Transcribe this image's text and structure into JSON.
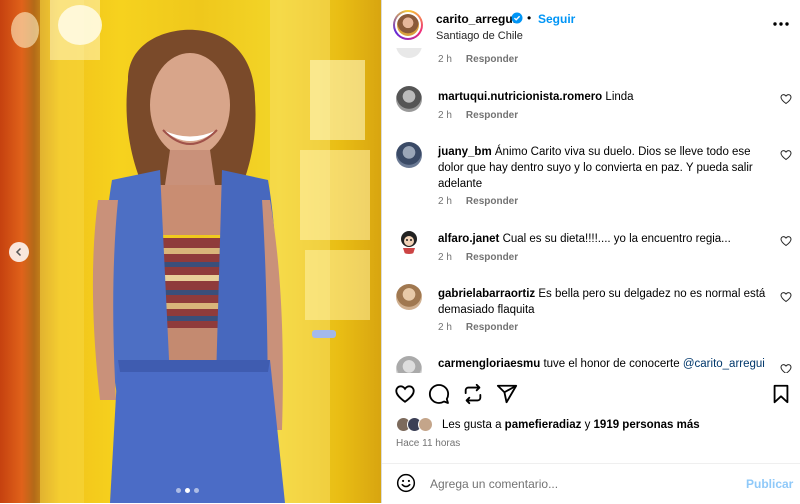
{
  "header": {
    "username": "carito_arregui",
    "separator": "•",
    "follow_label": "Seguir",
    "location": "Santiago de Chile",
    "avatar_icon": "profile-avatar",
    "more_icon": "more-options-icon"
  },
  "carousel": {
    "prev_icon": "chevron-left-icon",
    "slide_count": 3,
    "active_slide": 2
  },
  "comments": [
    {
      "username": "",
      "text": "",
      "time": "2 h",
      "reply_label": "Responder"
    },
    {
      "username": "martuqui.nutricionista.romero",
      "text": "Linda",
      "time": "2 h",
      "reply_label": "Responder"
    },
    {
      "username": "juany_bm",
      "text": "Ánimo Carito viva su duelo. Dios se lleve todo ese dolor que hay dentro suyo y lo convierta en paz. Y pueda salir adelante",
      "time": "2 h",
      "reply_label": "Responder"
    },
    {
      "username": "alfaro.janet",
      "text": "Cual es su dieta!!!!.... yo la encuentro regia...",
      "time": "2 h",
      "reply_label": "Responder"
    },
    {
      "username": "gabrielabarraortiz",
      "text": "Es bella pero su delgadez no es normal está demasiado flaquita",
      "time": "2 h",
      "reply_label": "Responder"
    },
    {
      "username": "carmengloriaesmu",
      "text": "tuve el honor de conocerte",
      "mention": "@carito_arregui",
      "time": "",
      "reply_label": ""
    }
  ],
  "actions": {
    "like_icon": "heart-icon",
    "comment_icon": "comment-icon",
    "repost_icon": "repost-icon",
    "share_icon": "send-icon",
    "save_icon": "bookmark-icon"
  },
  "likes": {
    "prefix": "Les gusta a",
    "first_user": "pamefieradiaz",
    "connector": "y",
    "others": "1919 personas más"
  },
  "posted_ago": "Hace 11 horas",
  "composer": {
    "emoji_icon": "emoji-icon",
    "placeholder": "Agrega un comentario...",
    "post_label": "Publicar"
  },
  "colors": {
    "accent": "#0095f6",
    "post_disabled": "#8fc9f9",
    "muted": "#737373",
    "mention": "#00376b"
  }
}
